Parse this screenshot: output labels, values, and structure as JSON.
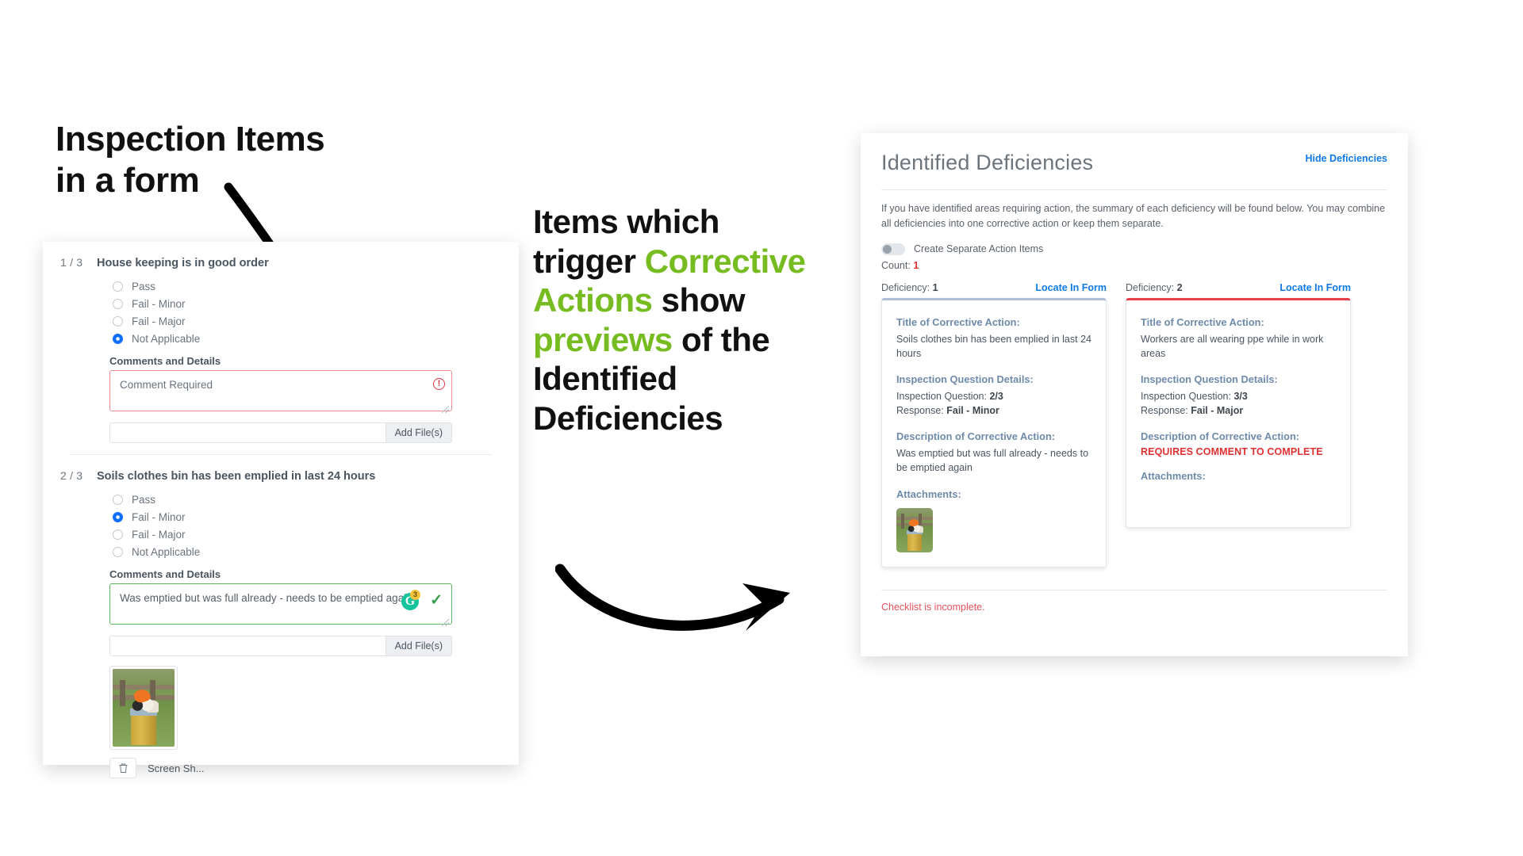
{
  "callouts": {
    "left": "Inspection Items in a form",
    "left_line1": "Inspection Items",
    "left_line2": "in a form",
    "mid_part1": "Items which",
    "mid_part2": "trigger ",
    "mid_hl1": "Corrective",
    "mid_hl2": "Actions",
    "mid_part3": " show",
    "mid_hl3": "previews",
    "mid_part4": " of the",
    "mid_part5": "Identified",
    "mid_part6": "Deficiencies"
  },
  "form": {
    "questions": [
      {
        "number": "1 / 3",
        "title": "House keeping is in good order",
        "options": [
          "Pass",
          "Fail - Minor",
          "Fail - Major",
          "Not Applicable"
        ],
        "selected": "Not Applicable",
        "comments_label": "Comments and Details",
        "comment_placeholder": "Comment Required",
        "comment_value": "",
        "state": "error",
        "file_button": "Add File(s)",
        "attachment": null
      },
      {
        "number": "2 / 3",
        "title": "Soils clothes bin has been emplied in last 24 hours",
        "options": [
          "Pass",
          "Fail - Minor",
          "Fail - Major",
          "Not Applicable"
        ],
        "selected": "Fail - Minor",
        "comments_label": "Comments and Details",
        "comment_placeholder": "",
        "comment_value": "Was emptied but was full already - needs to be emptied again",
        "state": "ok",
        "grammarly_count": "3",
        "file_button": "Add File(s)",
        "attachment": {
          "name": "Screen Sh..."
        }
      }
    ]
  },
  "deficiencies_panel": {
    "title": "Identified Deficiencies",
    "hide_link": "Hide Deficiencies",
    "description": "If you have identified areas requiring action, the summary of each deficiency will be found below. You may combine all deficiencies into one corrective action or keep them separate.",
    "toggle_label": "Create Separate Action Items",
    "toggle_on": false,
    "count_label": "Count:",
    "count_value": "1",
    "deficiency_label": "Deficiency:",
    "locate_link": "Locate In Form",
    "labels": {
      "title_of_ca": "Title of Corrective Action:",
      "inspection_details": "Inspection Question Details:",
      "inspection_question": "Inspection Question:",
      "response": "Response:",
      "description_of_ca": "Description of Corrective Action:",
      "attachments": "Attachments:"
    },
    "cards": [
      {
        "index": "1",
        "accent": "#aebfd4",
        "title": "Soils clothes bin has been emplied in last 24 hours",
        "question": "2/3",
        "response": "Fail - Minor",
        "description": "Was emptied but was full already - needs to be emptied again",
        "description_is_warning": false,
        "has_attachment": true
      },
      {
        "index": "2",
        "accent": "#e8414c",
        "title": "Workers are all wearing ppe while in work areas",
        "question": "3/3",
        "response": "Fail - Major",
        "description": "REQUIRES COMMENT TO COMPLETE",
        "description_is_warning": true,
        "has_attachment": false
      }
    ],
    "footer_status": "Checklist is incomplete."
  },
  "colors": {
    "accent_green": "#76bc21",
    "link_blue": "#0f7ae5",
    "danger_red": "#e03131",
    "radio_blue": "#0d6efd"
  }
}
